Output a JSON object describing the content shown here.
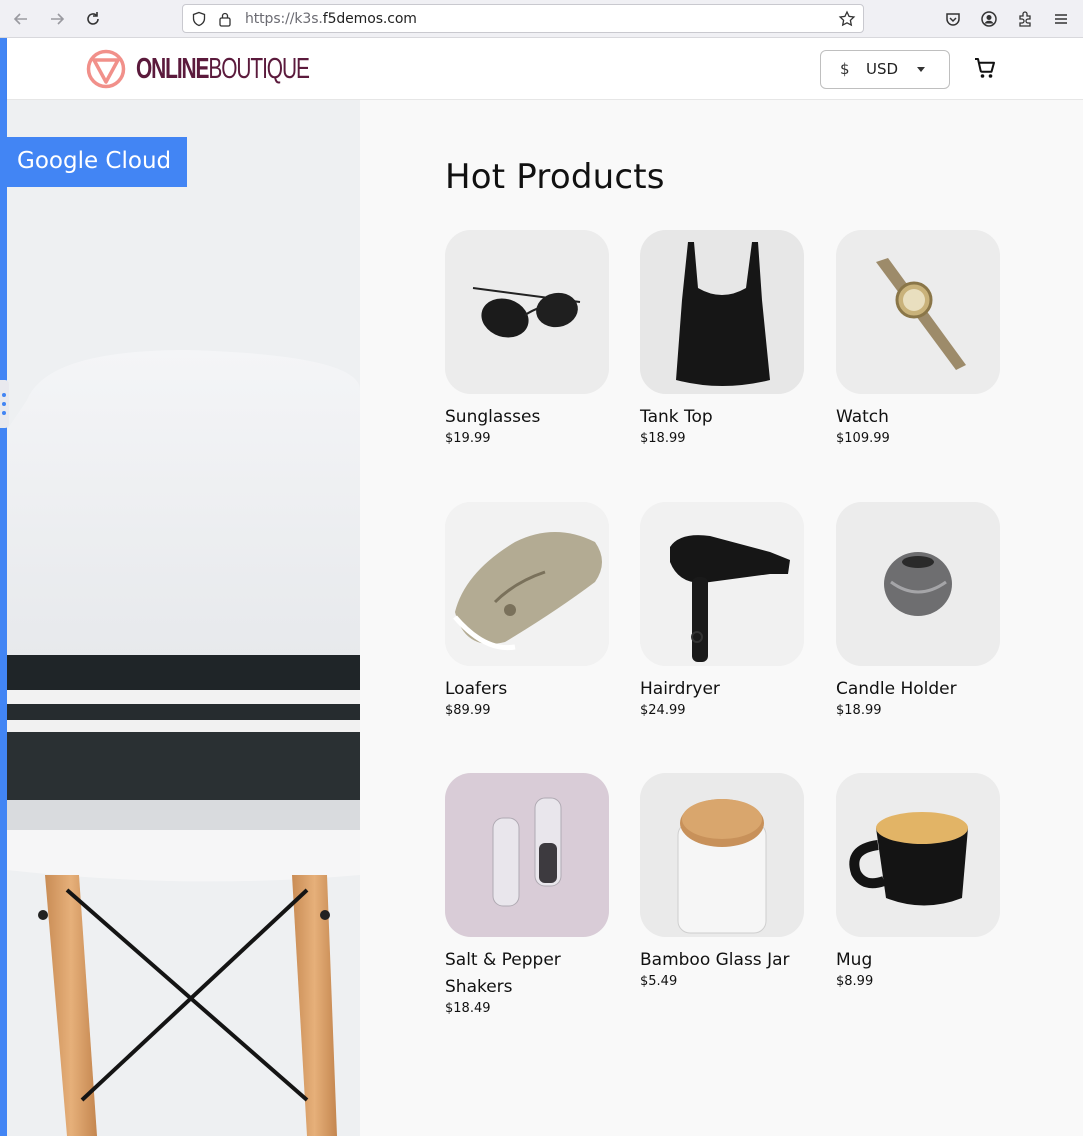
{
  "browser": {
    "url_prefix": "https://k3s.",
    "url_domain": "f5demos.com"
  },
  "header": {
    "logo_bold": "ONLINE",
    "logo_light": "BOUTIQUE",
    "currency_symbol": "$",
    "currency_code": "USD"
  },
  "hero": {
    "badge": "Google Cloud"
  },
  "main": {
    "title": "Hot Products",
    "products": [
      {
        "name": "Sunglasses",
        "price": "$19.99",
        "icon": "sunglasses-image"
      },
      {
        "name": "Tank Top",
        "price": "$18.99",
        "icon": "tank-top-image"
      },
      {
        "name": "Watch",
        "price": "$109.99",
        "icon": "watch-image"
      },
      {
        "name": "Loafers",
        "price": "$89.99",
        "icon": "loafers-image"
      },
      {
        "name": "Hairdryer",
        "price": "$24.99",
        "icon": "hairdryer-image"
      },
      {
        "name": "Candle Holder",
        "price": "$18.99",
        "icon": "candle-holder-image"
      },
      {
        "name": "Salt & Pepper Shakers",
        "price": "$18.49",
        "icon": "salt-pepper-image"
      },
      {
        "name": "Bamboo Glass Jar",
        "price": "$5.49",
        "icon": "bamboo-jar-image"
      },
      {
        "name": "Mug",
        "price": "$8.99",
        "icon": "mug-image"
      }
    ]
  },
  "colors": {
    "accent": "#4285f4",
    "logo": "#5b1a3c",
    "logo_mark": "#f1908a"
  }
}
